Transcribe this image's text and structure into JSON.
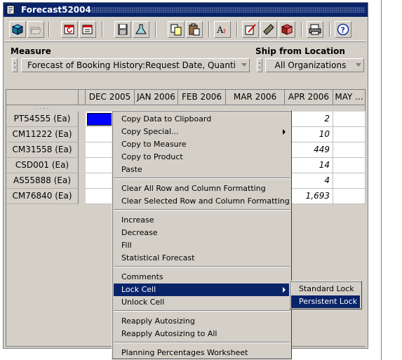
{
  "window": {
    "title": "Forecast52004"
  },
  "toolbar": {
    "icons": [
      "cube-icon",
      "open-folder-icon",
      "calendar-refresh-icon",
      "calendar-icon",
      "save-icon",
      "flask-icon",
      "copy-icon",
      "paste-icon",
      "font-size-icon",
      "edit-note-icon",
      "ruler-icon",
      "rubiks-cube-icon",
      "print-icon",
      "help-icon"
    ]
  },
  "measure": {
    "label": "Measure",
    "value": "Forecast of Booking History:Request Date, Quantity"
  },
  "ship_from": {
    "label": "Ship from Location",
    "value": "All Organizations"
  },
  "grid": {
    "row_hdr_dots": ". . . .",
    "columns": [
      "DEC 2005",
      "JAN 2006",
      "FEB 2006",
      "MAR 2006",
      "APR 2006",
      "MAY ..."
    ],
    "rows": [
      {
        "label": "PT54555 (Ea)",
        "apr": "2"
      },
      {
        "label": "CM11222 (Ea)",
        "apr": "10"
      },
      {
        "label": "CM31558 (Ea)",
        "apr": "449"
      },
      {
        "label": "CSD001 (Ea)",
        "apr": "14"
      },
      {
        "label": "AS55888 (Ea)",
        "apr": "4"
      },
      {
        "label": "CM76840 (Ea)",
        "apr": "1,693"
      }
    ]
  },
  "context_menu": {
    "copy_data": "Copy Data to Clipboard",
    "copy_special": "Copy Special...",
    "copy_measure": "Copy to Measure",
    "copy_product": "Copy to Product",
    "paste": "Paste",
    "clear_all": "Clear All Row and Column Formatting",
    "clear_selected": "Clear Selected Row and Column Formatting",
    "increase": "Increase",
    "decrease": "Decrease",
    "fill": "Fill",
    "stat_forecast": "Statistical Forecast",
    "comments": "Comments",
    "lock_cell": "Lock Cell",
    "unlock_cell": "Unlock Cell",
    "reapply_autosizing": "Reapply Autosizing",
    "reapply_all": "Reapply Autosizing to All",
    "planning_pct": "Planning Percentages Worksheet"
  },
  "submenu": {
    "standard_lock": "Standard Lock",
    "persistent_lock": "Persistent Lock"
  },
  "colors": {
    "title_bar": "#0a246a",
    "menu_highlight": "#0a246a",
    "selected_cell": "#0000ff",
    "chrome": "#d4d0c8"
  }
}
